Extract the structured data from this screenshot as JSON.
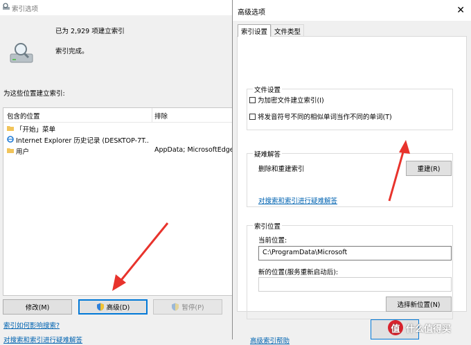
{
  "back_window": {
    "title": "索引选项",
    "indexed_count": "已为 2,929 项建立索引",
    "status": "索引完成。",
    "locations_label": "为这些位置建立索引:",
    "columns": {
      "included": "包含的位置",
      "exclude": "排除"
    },
    "rows": [
      {
        "name": "「开始」菜单",
        "exclude": "",
        "icon": "folder-icon"
      },
      {
        "name": "Internet Explorer 历史记录 (DESKTOP-7T...",
        "exclude": "",
        "icon": "ie-icon"
      },
      {
        "name": "用户",
        "exclude": "AppData; MicrosoftEdge",
        "icon": "folder-icon"
      }
    ],
    "buttons": {
      "modify": "修改(M)",
      "advanced": "高级(D)",
      "pause": "暂停(P)"
    },
    "links": {
      "how_affect": "索引如何影响搜索?",
      "troubleshoot": "对搜索和索引进行疑难解答"
    }
  },
  "dialog": {
    "title": "高级选项",
    "tabs": [
      "索引设置",
      "文件类型"
    ],
    "file_settings": {
      "legend": "文件设置",
      "encrypt_label": "为加密文件建立索引(I)",
      "diacritics_label": "将发音符号不同的相似单词当作不同的单词(T)"
    },
    "troubleshooting": {
      "legend": "疑难解答",
      "rebuild_label": "删除和重建索引",
      "rebuild_button": "重建(R)",
      "link": "对搜索和索引进行疑难解答"
    },
    "location": {
      "legend": "索引位置",
      "current_label": "当前位置:",
      "current_value": "C:\\ProgramData\\Microsoft",
      "new_label": "新的位置(服务重新启动后):",
      "new_value": "",
      "choose_button": "选择新位置(N)"
    },
    "help_link": "高级索引帮助",
    "watermark": "什么值得买"
  },
  "colors": {
    "link": "#0063b1",
    "focus": "#0078d7",
    "arrow": "#e8332c"
  }
}
